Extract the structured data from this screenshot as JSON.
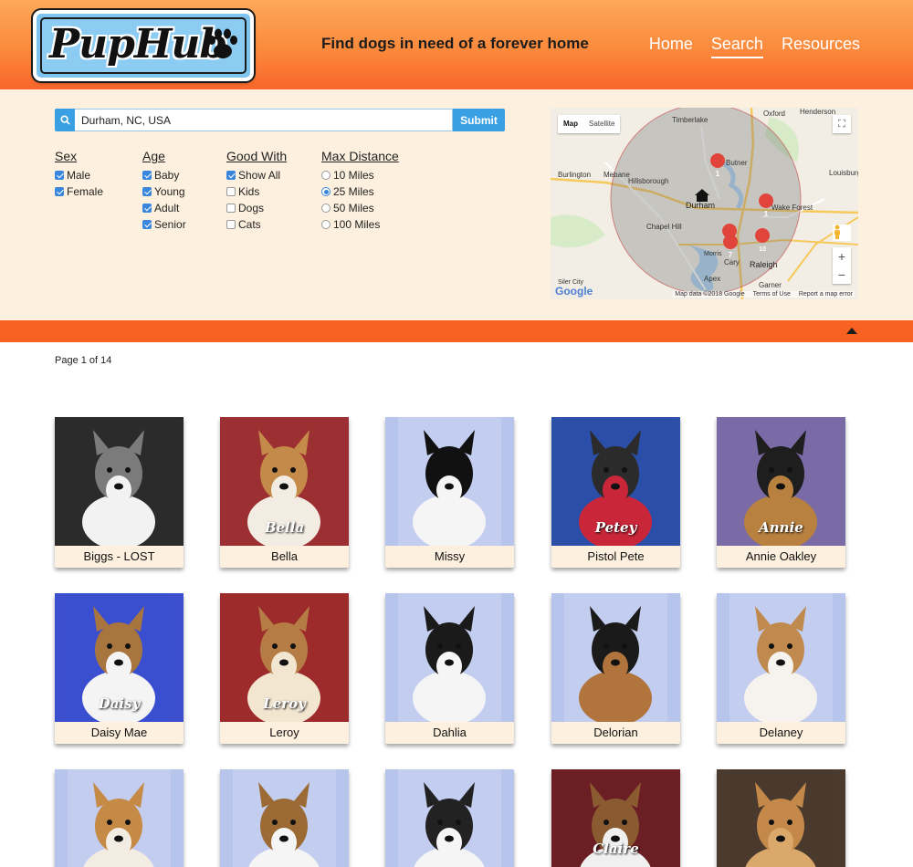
{
  "header": {
    "logo_text": "PupHub",
    "tagline": "Find dogs in need of a forever home",
    "nav": [
      {
        "label": "Home",
        "active": false
      },
      {
        "label": "Search",
        "active": true
      },
      {
        "label": "Resources",
        "active": false
      }
    ]
  },
  "search": {
    "value": "Durham, NC, USA",
    "submit_label": "Submit"
  },
  "filters": {
    "sex": {
      "title": "Sex",
      "options": [
        {
          "label": "Male",
          "checked": true
        },
        {
          "label": "Female",
          "checked": true
        }
      ]
    },
    "age": {
      "title": "Age",
      "options": [
        {
          "label": "Baby",
          "checked": true
        },
        {
          "label": "Young",
          "checked": true
        },
        {
          "label": "Adult",
          "checked": true
        },
        {
          "label": "Senior",
          "checked": true
        }
      ]
    },
    "good_with": {
      "title": "Good With",
      "options": [
        {
          "label": "Show All",
          "checked": true
        },
        {
          "label": "Kids",
          "checked": false
        },
        {
          "label": "Dogs",
          "checked": false
        },
        {
          "label": "Cats",
          "checked": false
        }
      ]
    },
    "max_distance": {
      "title": "Max Distance",
      "options": [
        {
          "label": "10 Miles",
          "selected": false
        },
        {
          "label": "25 Miles",
          "selected": true
        },
        {
          "label": "50 Miles",
          "selected": false
        },
        {
          "label": "100 Miles",
          "selected": false
        }
      ]
    }
  },
  "map": {
    "toggle_map": "Map",
    "toggle_satellite": "Satellite",
    "places": {
      "oxford": "Oxford",
      "timberlake": "Timberlake",
      "butner": "Butner",
      "burlington": "Burlington",
      "mebane": "Mebane",
      "hillsborough": "Hillsborough",
      "durham": "Durham",
      "louisburg": "Louisburg",
      "wake_forest": "Wake Forest",
      "chapel_hill": "Chapel Hill",
      "morrisville": "Morris",
      "cary": "Cary",
      "raleigh": "Raleigh",
      "apex": "Apex",
      "siler_city": "Siler City",
      "garner": "Garner",
      "henderson": "Henderson"
    },
    "markers": [
      "1",
      "1",
      "1",
      "7",
      "10"
    ],
    "zoom_in": "+",
    "zoom_out": "−",
    "google": "Google",
    "map_data": "Map data ©2018 Google",
    "terms": "Terms of Use",
    "report": "Report a map error"
  },
  "pagination": {
    "text": "Page 1 of 14"
  },
  "dogs": [
    {
      "name": "Biggs - LOST",
      "bg": "#2b2b2b",
      "coat": "#7b7b7b",
      "coat2": "#f2f2f2"
    },
    {
      "name": "Bella",
      "bg": "#9c2f33",
      "coat": "#c48a4a",
      "coat2": "#f3ece2",
      "overlay": "Bella"
    },
    {
      "name": "Missy",
      "bg": "#b7c4eb",
      "coat": "#111111",
      "coat2": "#f5f5f5"
    },
    {
      "name": "Pistol Pete",
      "bg": "#2c4fa8",
      "coat": "#2b2b2b",
      "coat2": "#c9263a",
      "overlay": "Petey"
    },
    {
      "name": "Annie Oakley",
      "bg": "#7a6aa6",
      "coat": "#1e1e1e",
      "coat2": "#b8813f",
      "overlay": "Annie"
    },
    {
      "name": "Daisy Mae",
      "bg": "#3b4fcf",
      "coat": "#a8753f",
      "coat2": "#f4f4f4",
      "overlay": "Daisy"
    },
    {
      "name": "Leroy",
      "bg": "#9e2b2b",
      "coat": "#b57c45",
      "coat2": "#f3e6d0",
      "overlay": "Leroy"
    },
    {
      "name": "Dahlia",
      "bg": "#b7c4eb",
      "coat": "#1a1a1a",
      "coat2": "#f5f5f5"
    },
    {
      "name": "Delorian",
      "bg": "#b7c4eb",
      "coat": "#1a1a1a",
      "coat2": "#b0743c"
    },
    {
      "name": "Delaney",
      "bg": "#b7c4eb",
      "coat": "#c08a4e",
      "coat2": "#f6f3ee"
    },
    {
      "name": "",
      "bg": "#b7c4eb",
      "coat": "#c58a45",
      "coat2": "#f3ece2"
    },
    {
      "name": "",
      "bg": "#b7c4eb",
      "coat": "#9b6a35",
      "coat2": "#f5f5f5"
    },
    {
      "name": "",
      "bg": "#b7c4eb",
      "coat": "#222222",
      "coat2": "#f5f5f5"
    },
    {
      "name": "",
      "bg": "#6b1f24",
      "coat": "#8a5a30",
      "coat2": "#f0f0f0",
      "overlay": "Claire"
    },
    {
      "name": "",
      "bg": "#4a3b2e",
      "coat": "#c4894a",
      "coat2": "#d9a86a"
    }
  ],
  "colors": {
    "header_top": "#fda85a",
    "header_bottom": "#f8652a",
    "panel_bg": "#fdf0de",
    "accent_blue": "#3aa0e4",
    "orange_bar": "#f76223"
  }
}
